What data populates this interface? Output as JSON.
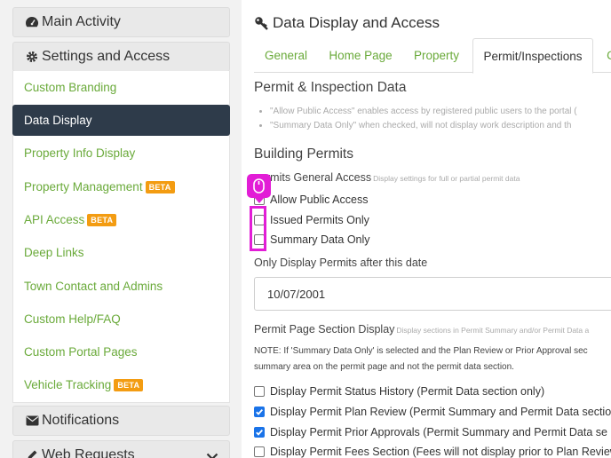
{
  "sidebar": {
    "headers": {
      "main_activity": "Main Activity",
      "settings_access": "Settings and Access",
      "notifications": "Notifications",
      "web_requests": "Web Requests"
    },
    "items": [
      {
        "label": "Custom Branding",
        "beta": ""
      },
      {
        "label": "Data Display",
        "beta": ""
      },
      {
        "label": "Property Info Display",
        "beta": ""
      },
      {
        "label": "Property Management",
        "beta": "BETA"
      },
      {
        "label": "API Access",
        "beta": "BETA"
      },
      {
        "label": "Deep Links",
        "beta": ""
      },
      {
        "label": "Town Contact and Admins",
        "beta": ""
      },
      {
        "label": "Custom Help/FAQ",
        "beta": ""
      },
      {
        "label": "Custom Portal Pages",
        "beta": ""
      },
      {
        "label": "Vehicle Tracking",
        "beta": "BETA"
      }
    ]
  },
  "main": {
    "title": "Data Display and Access",
    "tabs": [
      "General",
      "Home Page",
      "Property",
      "Permit/Inspections",
      "C"
    ],
    "active_tab": "Permit/Inspections",
    "permit_inspection_section": {
      "title": "Permit & Inspection Data",
      "bullets": [
        "\"Allow Public Access\" enables access by registered public users to the portal (",
        "\"Summary Data Only\" when checked, will not display work description and th"
      ]
    },
    "building_permits": {
      "title": "Building Permits",
      "general_access_label": "rmits General Access",
      "general_access_hint": "Display settings for full or partial permit data",
      "options": [
        {
          "label": "Allow Public Access",
          "checked": false
        },
        {
          "label": "Issued Permits Only",
          "checked": false
        },
        {
          "label": "Summary Data Only",
          "checked": false
        }
      ],
      "date_label": "Only Display Permits after this date",
      "date_value": "10/07/2001",
      "section_display_label": "Permit Page Section Display",
      "section_display_hint": "Display sections in Permit Summary and/or Permit Data a",
      "note_line1": "NOTE: If 'Summary Data Only' is selected and the Plan Review or Prior Approval sec",
      "note_line2": "summary area on the permit page and not the permit data section.",
      "sections": [
        {
          "label": "Display Permit Status History (Permit Data section only)",
          "checked": false
        },
        {
          "label": "Display Permit Plan Review (Permit Summary and Permit Data sectio",
          "checked": true
        },
        {
          "label": "Display Permit Prior Approvals (Permit Summary and Permit Data se",
          "checked": true
        },
        {
          "label": "Display Permit Fees Section (Fees will not display prior to Plan Review",
          "checked": false
        }
      ]
    }
  },
  "colors": {
    "accent_green": "#6aaa3a",
    "active_nav": "#2e3b4a",
    "beta_badge": "#f39c12",
    "checkbox_checked": "#1a73e8",
    "annotation_magenta": "#e21dd6"
  }
}
